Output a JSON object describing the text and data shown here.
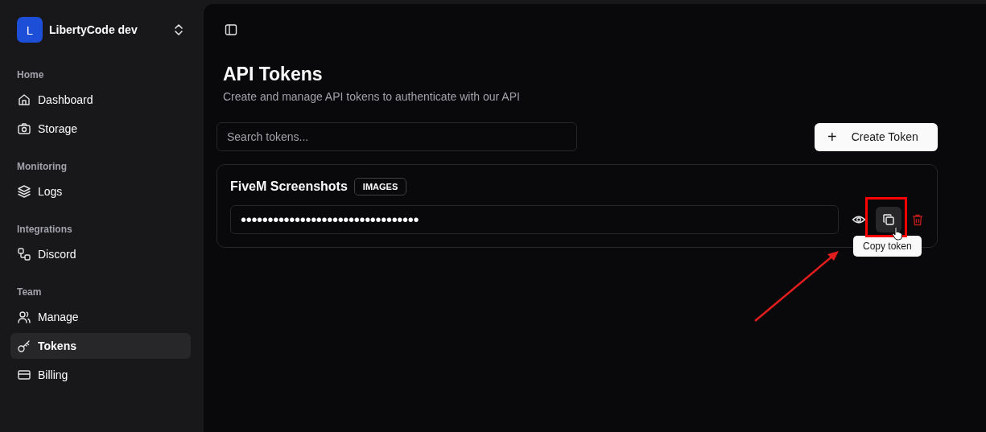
{
  "team_switcher": {
    "avatar": "L",
    "name": "LibertyCode dev"
  },
  "sidebar": {
    "groups": [
      {
        "label": "Home",
        "items": [
          {
            "label": "Dashboard",
            "kind": "home",
            "selected": false
          },
          {
            "label": "Storage",
            "kind": "camera",
            "selected": false
          }
        ]
      },
      {
        "label": "Monitoring",
        "items": [
          {
            "label": "Logs",
            "kind": "layers",
            "selected": false
          }
        ]
      },
      {
        "label": "Integrations",
        "items": [
          {
            "label": "Discord",
            "kind": "workflow",
            "selected": false
          }
        ]
      },
      {
        "label": "Team",
        "items": [
          {
            "label": "Manage",
            "kind": "users",
            "selected": false
          },
          {
            "label": "Tokens",
            "kind": "key",
            "selected": true
          },
          {
            "label": "Billing",
            "kind": "card",
            "selected": false
          }
        ]
      }
    ]
  },
  "page": {
    "title": "API Tokens",
    "subtitle": "Create and manage API tokens to authenticate with our API"
  },
  "search": {
    "placeholder": "Search tokens..."
  },
  "create_button": {
    "icon": "+",
    "label": "Create Token"
  },
  "tokens": [
    {
      "name": "FiveM Screenshots",
      "tag": "IMAGES",
      "value": "•••••••••••••••••••••••••••••••••",
      "copy_hovered": true,
      "tooltip": "Copy token"
    }
  ]
}
